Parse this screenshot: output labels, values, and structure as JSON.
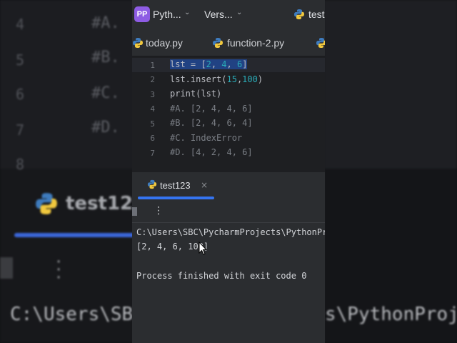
{
  "background": {
    "line_numbers": [
      "4",
      "5",
      "6",
      "7",
      "8"
    ],
    "comments": [
      "#A.",
      "#B.",
      "#C.",
      "#D."
    ],
    "run_tab": "test12",
    "path_left": "C:\\Users\\SB",
    "path_right": "s\\PythonProj"
  },
  "titlebar": {
    "project_badge": "PP",
    "project_name": "Pyth...",
    "vcs_label": "Vers...",
    "run_config": "test"
  },
  "tabs": [
    {
      "label": "today.py",
      "icon": "python-file-icon"
    },
    {
      "label": "function-2.py",
      "icon": "python-file-icon"
    }
  ],
  "editor": {
    "line_numbers": [
      "1",
      "2",
      "3",
      "4",
      "5",
      "6",
      "7"
    ],
    "lines": [
      "lst = [2, 4, 6]",
      "lst.insert(15,100)",
      "print(lst)",
      "#A. [2, 4, 4, 6]",
      "#B. [2, 4, 6, 4]",
      "#C. IndexError",
      "#D. [4, 2, 4, 6]"
    ]
  },
  "run": {
    "tab_label": "test123",
    "close": "×",
    "menu": "⋮",
    "console": [
      "C:\\Users\\SBC\\PycharmProjects\\PythonProj",
      "[2, 4, 6, 100]",
      "",
      "Process finished with exit code 0"
    ]
  },
  "colors": {
    "accent": "#3574f0",
    "project_badge": "#8e5ce4",
    "number": "#2aacb8",
    "comment": "#7a7e85",
    "selection": "#214283"
  }
}
